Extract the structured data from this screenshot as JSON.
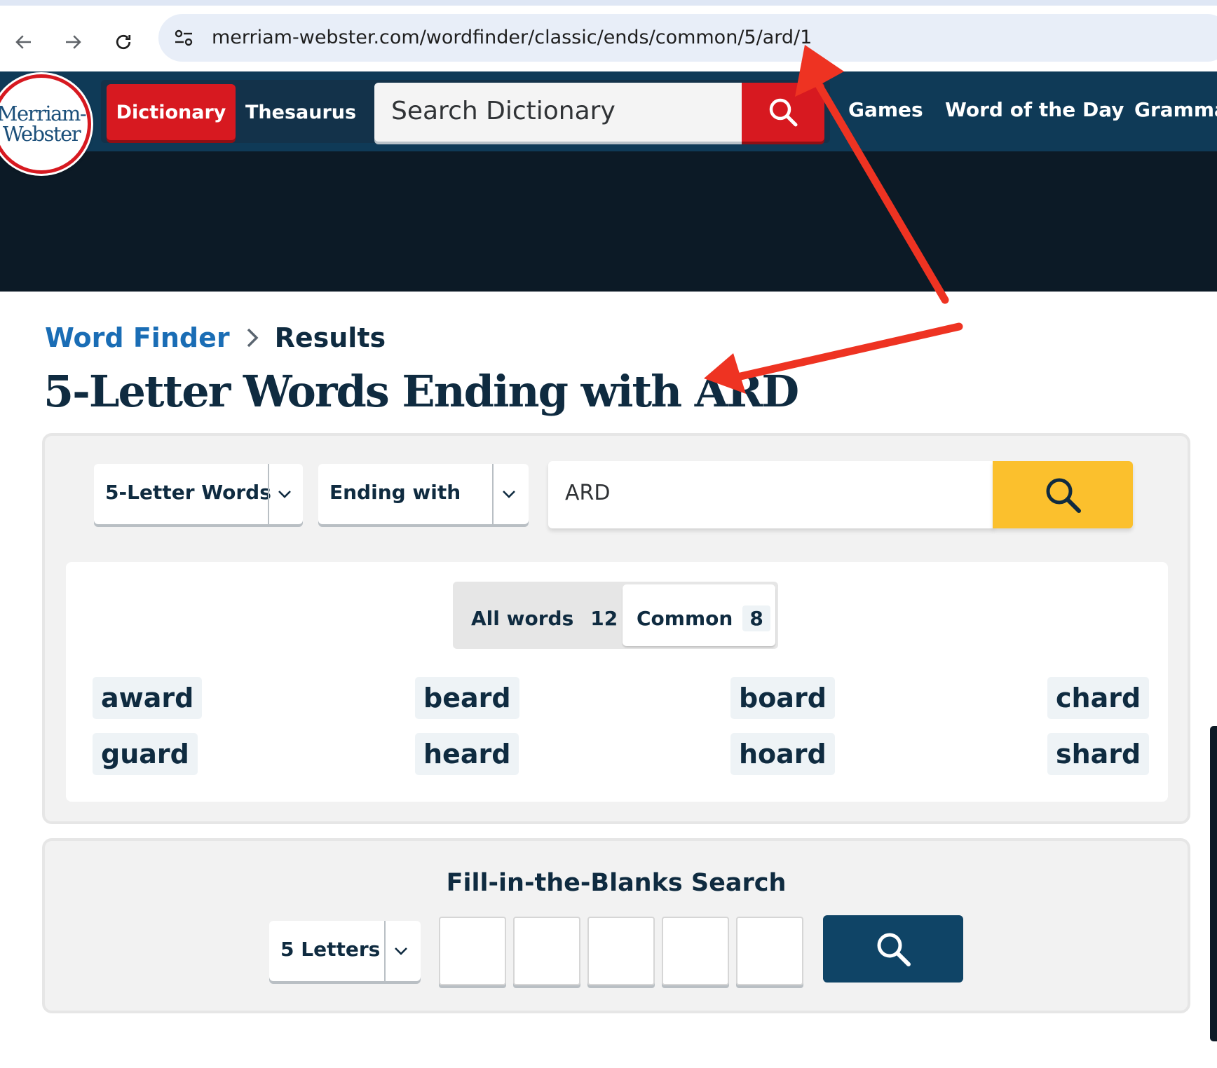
{
  "browser": {
    "url": "merriam-webster.com/wordfinder/classic/ends/common/5/ard/1"
  },
  "header": {
    "logo_line1": "Merriam-",
    "logo_line2": "Webster",
    "tab_dictionary": "Dictionary",
    "tab_thesaurus": "Thesaurus",
    "search_placeholder": "Search Dictionary",
    "nav_links": [
      "Games",
      "Word of the Day",
      "Gramma"
    ]
  },
  "breadcrumb": {
    "link": "Word Finder",
    "current": "Results"
  },
  "page_title": "5-Letter Words Ending with ARD",
  "filters": {
    "length_select": "5-Letter Words",
    "position_select": "Ending with",
    "letters_value": "ARD"
  },
  "toggle": {
    "all_label": "All words",
    "all_count": "12",
    "common_label": "Common",
    "common_count": "8",
    "selected": "Common"
  },
  "words": [
    "award",
    "beard",
    "board",
    "chard",
    "guard",
    "heard",
    "hoard",
    "shard"
  ],
  "blanks": {
    "title": "Fill-in-the-Blanks Search",
    "length_select": "5 Letters",
    "box_count": 5
  },
  "colors": {
    "brand_red": "#d71920",
    "nav_blue": "#0f3a57",
    "search_yellow": "#fbc02d",
    "annotation_arrow": "#ee3322"
  }
}
